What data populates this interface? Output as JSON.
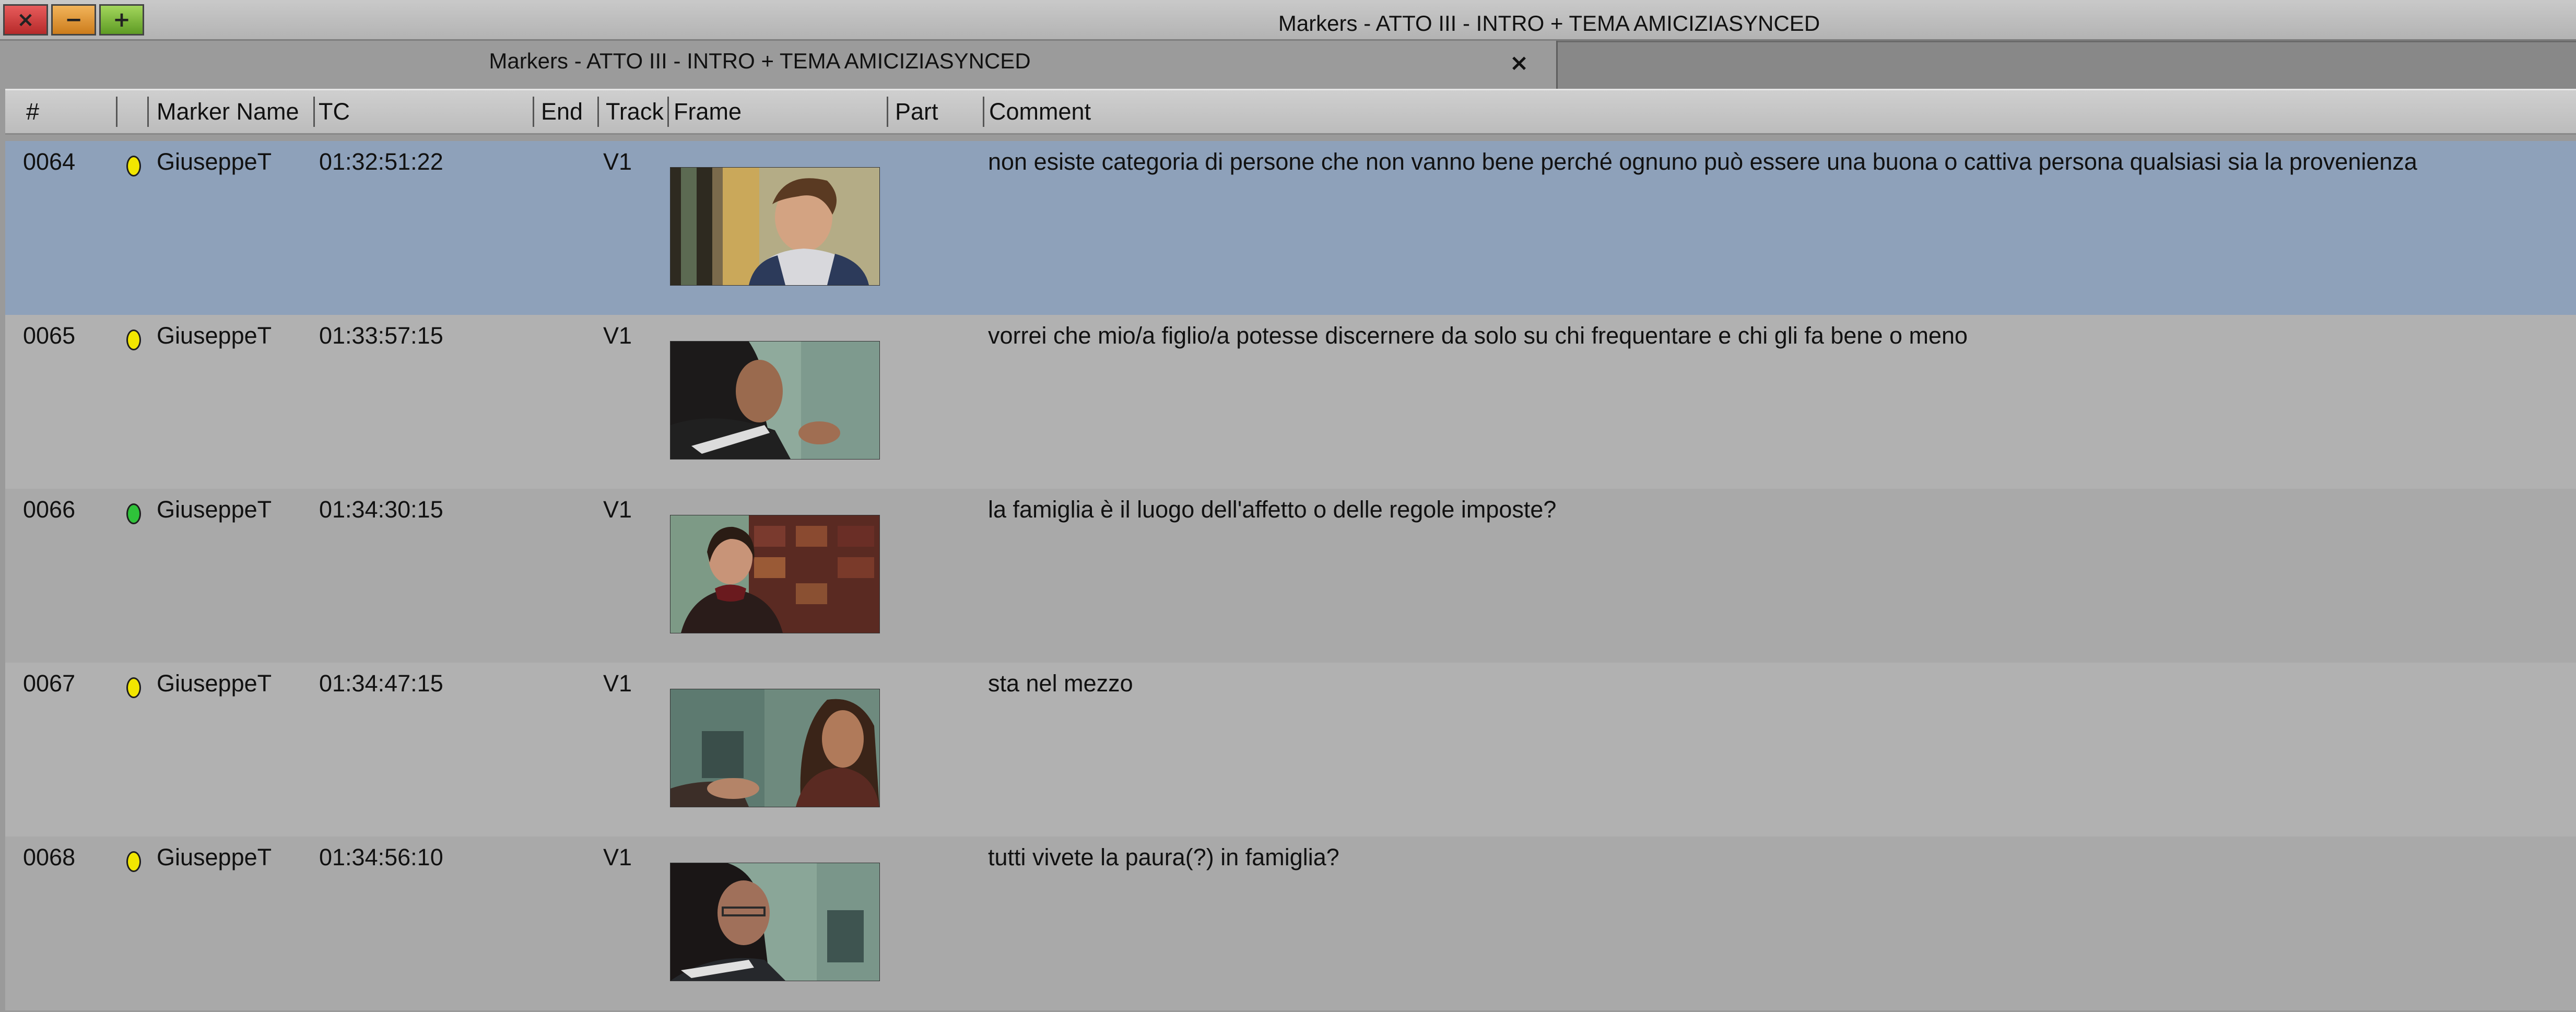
{
  "window": {
    "title": "Markers - ATTO III - INTRO + TEMA AMICIZIASYNCED"
  },
  "window_buttons": {
    "close": "×",
    "minimize": "−",
    "maximize": "+"
  },
  "tab": {
    "label": "Markers - ATTO III - INTRO + TEMA AMICIZIASYNCED",
    "close": "×"
  },
  "columns": {
    "num": "#",
    "marker_name": "Marker Name",
    "tc": "TC",
    "end": "End",
    "track": "Track",
    "frame": "Frame",
    "part": "Part",
    "comment": "Comment"
  },
  "colors": {
    "selected_row": "#8ea1ba",
    "marker_yellow": "#f2e600",
    "marker_green": "#2fc23a"
  },
  "rows": [
    {
      "num": "0064",
      "marker_color": "yellow",
      "name": "GiuseppeT",
      "tc": "01:32:51:22",
      "track": "V1",
      "comment": "non esiste categoria di persone che non vanno bene perché ognuno può essere una buona o cattiva persona qualsiasi sia la provenienza",
      "selected": true,
      "frame_icon": "thumbnail-young-man-smiling"
    },
    {
      "num": "0065",
      "marker_color": "yellow",
      "name": "GiuseppeT",
      "tc": "01:33:57:15",
      "track": "V1",
      "comment": "vorrei che mio/a figlio/a potesse discernere da solo su chi frequentare e chi gli fa bene o meno",
      "selected": false,
      "frame_icon": "thumbnail-girl-gesturing"
    },
    {
      "num": "0066",
      "marker_color": "green",
      "name": "GiuseppeT",
      "tc": "01:34:30:15",
      "track": "V1",
      "comment": "la famiglia è il luogo dell'affetto o delle regole imposte?",
      "selected": false,
      "frame_icon": "thumbnail-girl-bookshelf"
    },
    {
      "num": "0067",
      "marker_color": "yellow",
      "name": "GiuseppeT",
      "tc": "01:34:47:15",
      "track": "V1",
      "comment": "sta nel mezzo",
      "selected": false,
      "frame_icon": "thumbnail-two-people"
    },
    {
      "num": "0068",
      "marker_color": "yellow",
      "name": "GiuseppeT",
      "tc": "01:34:56:10",
      "track": "V1",
      "comment": "tutti vivete la paura(?) in famiglia?",
      "selected": false,
      "frame_icon": "thumbnail-girl-glasses"
    }
  ]
}
